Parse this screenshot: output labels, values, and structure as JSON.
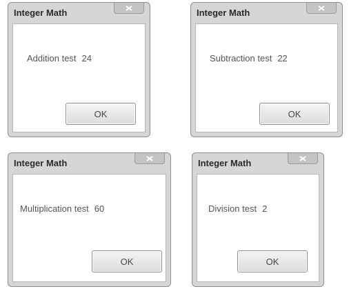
{
  "dialogs": [
    {
      "title": "Integer Math",
      "label": "Addition test",
      "value": "24",
      "button": "OK"
    },
    {
      "title": "Integer Math",
      "label": "Subtraction test",
      "value": "22",
      "button": "OK"
    },
    {
      "title": "Integer Math",
      "label": "Multiplication test",
      "value": "60",
      "button": "OK"
    },
    {
      "title": "Integer Math",
      "label": "Division test",
      "value": "2",
      "button": "OK"
    }
  ],
  "icons": {
    "close": "close-icon"
  }
}
